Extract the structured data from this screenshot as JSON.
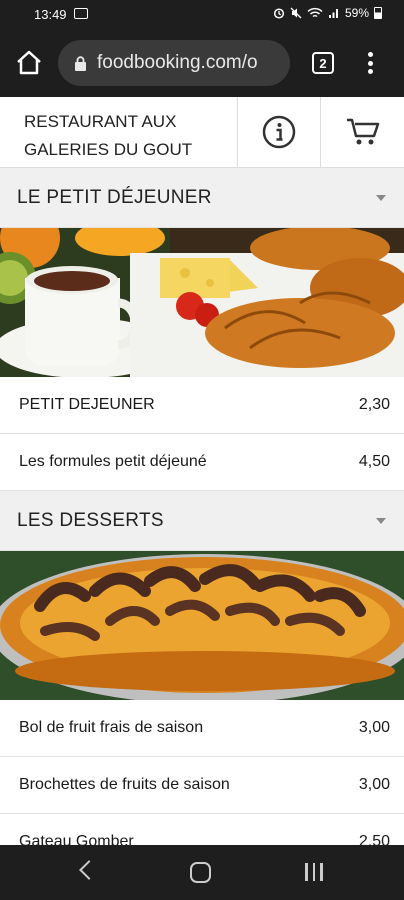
{
  "status": {
    "time": "13:49",
    "battery": "59%"
  },
  "browser": {
    "url": "foodbooking.com/o",
    "tab_count": "2"
  },
  "header": {
    "title_line1": "RESTAURANT AUX",
    "title_line2": "GALERIES DU GOUT"
  },
  "sections": [
    {
      "title": "LE PETIT DÉJEUNER",
      "items": [
        {
          "name": "PETIT DEJEUNER",
          "price": "2,30"
        },
        {
          "name": "Les formules petit déjeuné",
          "price": "4,50"
        }
      ]
    },
    {
      "title": "LES DESSERTS",
      "items": [
        {
          "name": "Bol de fruit frais de saison",
          "price": "3,00"
        },
        {
          "name": "Brochettes de fruits de saison",
          "price": "3,00"
        },
        {
          "name": "Gateau Gomber",
          "price": "2,50"
        }
      ]
    }
  ]
}
